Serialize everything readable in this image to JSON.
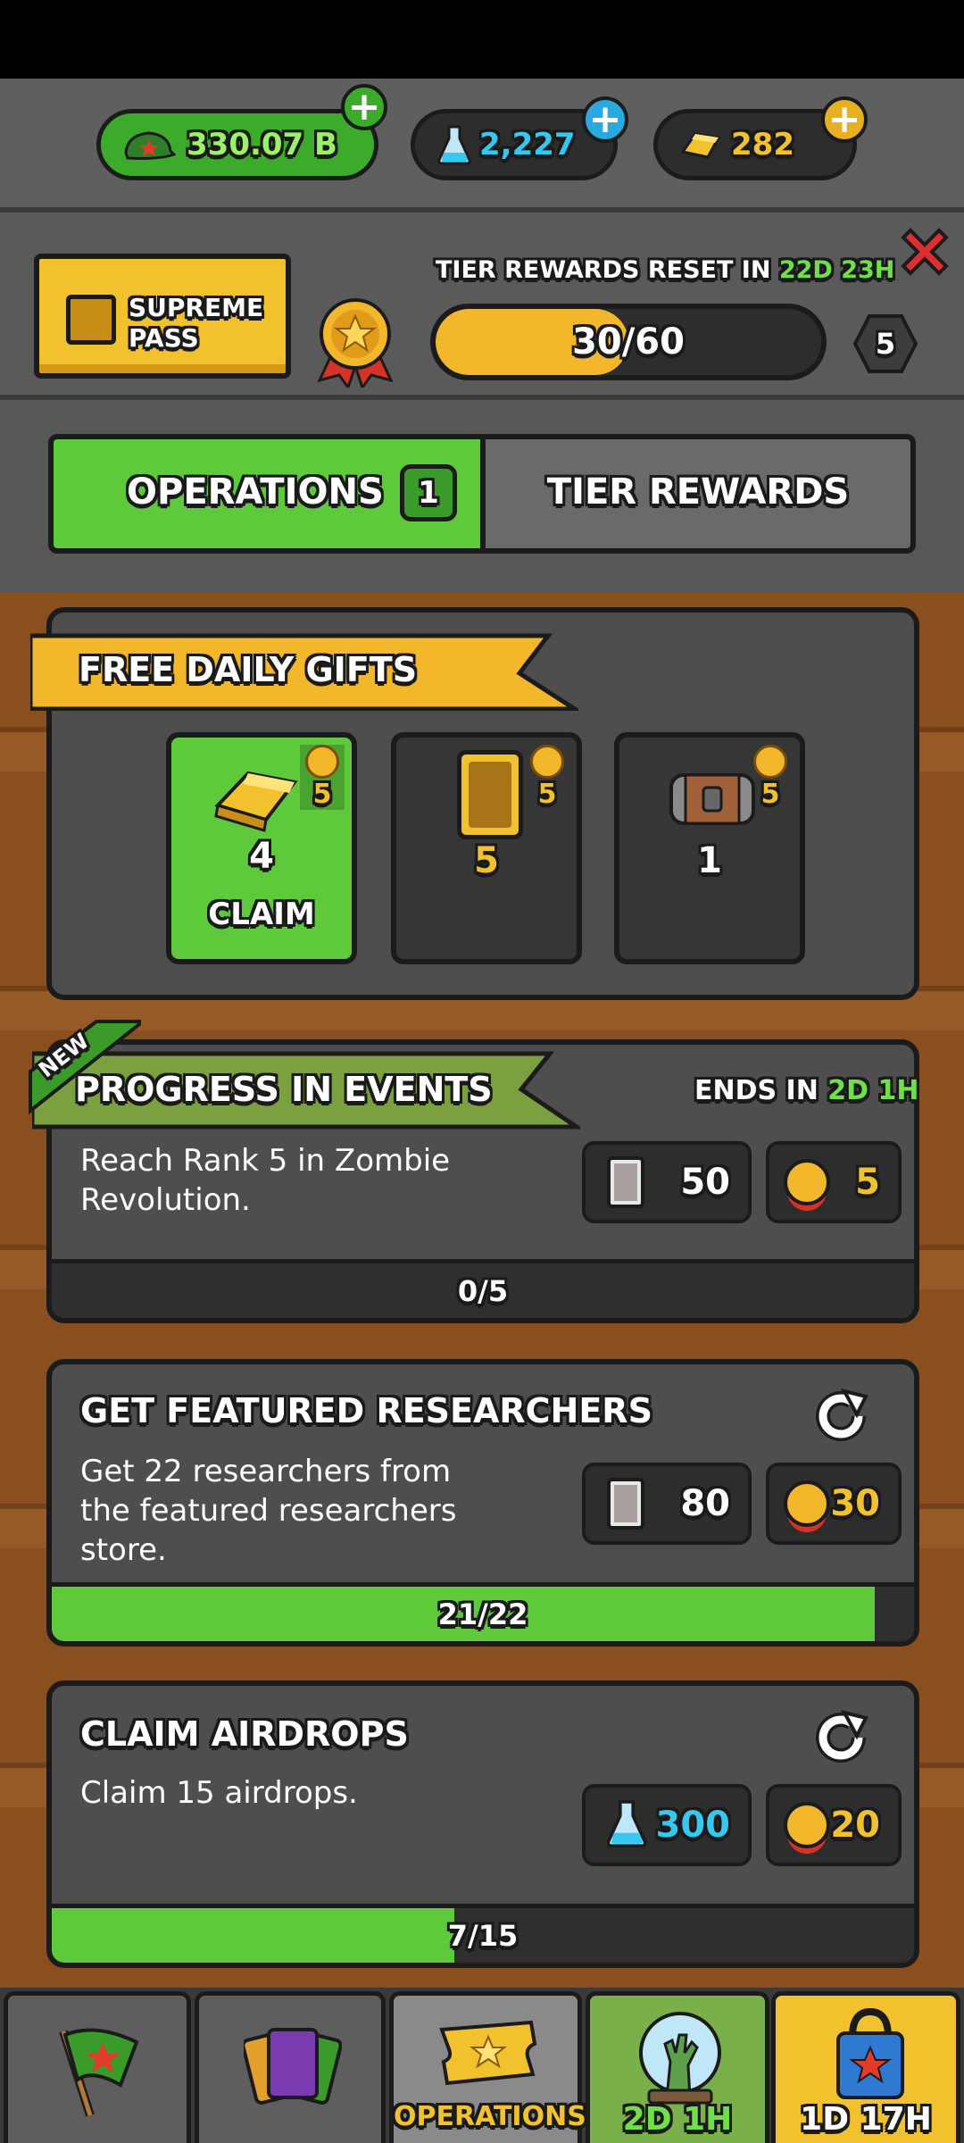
{
  "currencies": {
    "cash": "330.07 B",
    "science": "2,227",
    "gold": "282"
  },
  "pass": {
    "label_line1": "SUPREME",
    "label_line2": "PASS",
    "reset_label": "TIER REWARDS RESET IN",
    "reset_time": "22D 23H",
    "progress_text": "30/60",
    "progress_fraction": 0.5,
    "tier_level": "5"
  },
  "tabs": {
    "operations": "OPERATIONS",
    "operations_badge": "1",
    "tier_rewards": "TIER REWARDS"
  },
  "daily_gifts": {
    "title": "FREE DAILY GIFTS",
    "items": [
      {
        "icon": "gold-bars-icon",
        "count": "4",
        "medals": "5",
        "action": "CLAIM"
      },
      {
        "icon": "card-icon",
        "count": "5",
        "medals": "5"
      },
      {
        "icon": "chest-icon",
        "count": "1",
        "medals": "5"
      }
    ]
  },
  "tasks": [
    {
      "badge": "NEW",
      "title": "PROGRESS IN EVENTS",
      "ends_label": "ENDS IN",
      "ends_time": "2D 1H",
      "desc": "Reach Rank 5 in Zombie Revolution.",
      "reward1": "50",
      "reward2": "5",
      "progress_text": "0/5",
      "progress_fraction": 0
    },
    {
      "title": "GET FEATURED RESEARCHERS",
      "desc": "Get 22 researchers from the featured researchers store.",
      "reward1": "80",
      "reward2": "30",
      "progress_text": "21/22",
      "progress_fraction": 0.9545
    },
    {
      "title": "CLAIM AIRDROPS",
      "desc": "Claim 15 airdrops.",
      "reward1": "300",
      "reward2": "20",
      "progress_text": "7/15",
      "progress_fraction": 0.4667
    }
  ],
  "nav": {
    "operations": "OPERATIONS",
    "event_timer": "2D 1H",
    "shop_timer": "1D 17H"
  },
  "colors": {
    "green": "#5ec93a",
    "yellow": "#f2c12e",
    "cyan": "#35c8f0",
    "panel": "#4e4e4e"
  }
}
